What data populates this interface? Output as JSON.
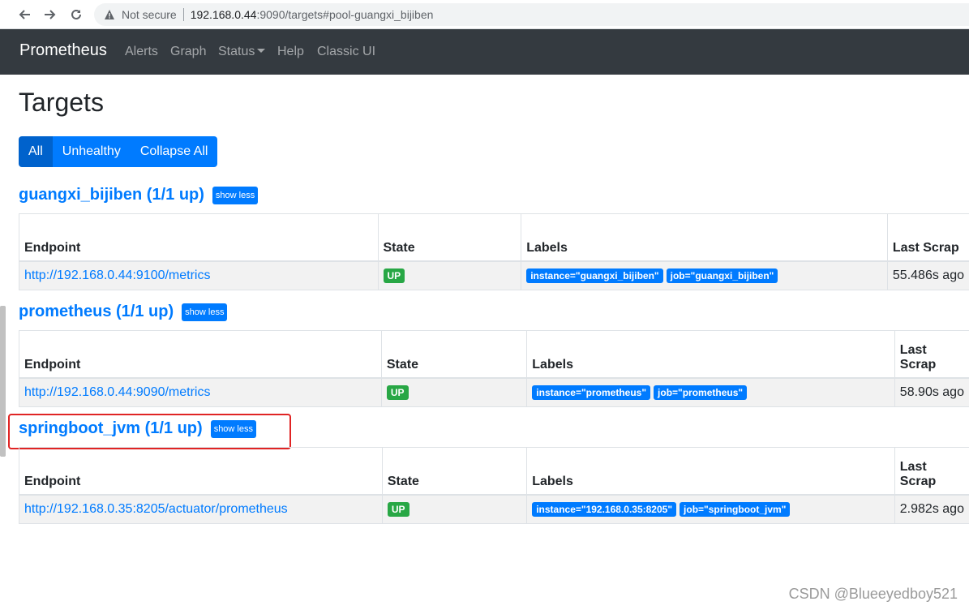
{
  "browser": {
    "not_secure": "Not secure",
    "url_host": "192.168.0.44",
    "url_rest": ":9090/targets#pool-guangxi_bijiben"
  },
  "navbar": {
    "brand": "Prometheus",
    "links": [
      "Alerts",
      "Graph",
      "Status",
      "Help",
      "Classic UI"
    ]
  },
  "page": {
    "title": "Targets",
    "filters": [
      "All",
      "Unhealthy",
      "Collapse All"
    ]
  },
  "table_headers": {
    "endpoint": "Endpoint",
    "state": "State",
    "labels": "Labels",
    "last_scrape": "Last Scrap"
  },
  "pools": [
    {
      "title": "guangxi_bijiben (1/1 up)",
      "toggle": "show less",
      "endpoint": "http://192.168.0.44:9100/metrics",
      "state": "UP",
      "labels": [
        "instance=\"guangxi_bijiben\"",
        "job=\"guangxi_bijiben\""
      ],
      "last_scrape": "55.486s ago"
    },
    {
      "title": "prometheus (1/1 up)",
      "toggle": "show less",
      "endpoint": "http://192.168.0.44:9090/metrics",
      "state": "UP",
      "labels": [
        "instance=\"prometheus\"",
        "job=\"prometheus\""
      ],
      "last_scrape": "58.90s ago"
    },
    {
      "title": "springboot_jvm (1/1 up)",
      "toggle": "show less",
      "endpoint": "http://192.168.0.35:8205/actuator/prometheus",
      "state": "UP",
      "labels": [
        "instance=\"192.168.0.35:8205\"",
        "job=\"springboot_jvm\""
      ],
      "last_scrape": "2.982s ago"
    }
  ],
  "watermark": "CSDN @Blueeyedboy521",
  "colors": {
    "navbar": "#343a40",
    "primary": "#007bff",
    "success": "#28a745",
    "highlight": "#e02424"
  }
}
